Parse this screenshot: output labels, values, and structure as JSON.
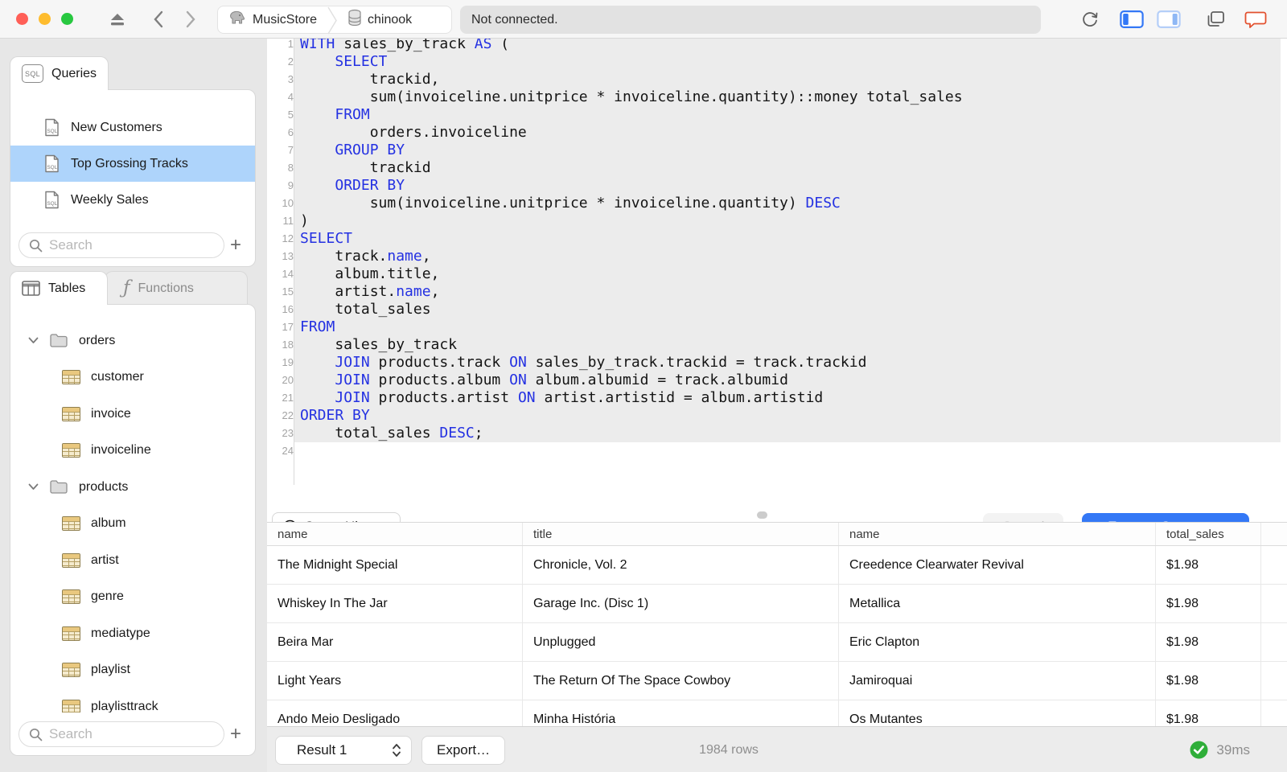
{
  "titlebar": {
    "breadcrumb": {
      "server": "MusicStore",
      "database": "chinook"
    },
    "status": "Not connected."
  },
  "colors": {
    "accent_blue": "#3478f6",
    "selection_blue": "#aed4fb",
    "keyword_blue": "#2431e2",
    "success_green": "#2fae39",
    "chat_orange": "#e2502e"
  },
  "sidebar": {
    "queries_tab": "Queries",
    "queries": [
      {
        "label": "New Customers",
        "selected": false
      },
      {
        "label": "Top Grossing Tracks",
        "selected": true
      },
      {
        "label": "Weekly Sales",
        "selected": false
      }
    ],
    "queries_search_placeholder": "Search",
    "tables_tab": "Tables",
    "functions_tab": "Functions",
    "tree": [
      {
        "type": "folder",
        "label": "orders"
      },
      {
        "type": "table",
        "label": "customer"
      },
      {
        "type": "table",
        "label": "invoice"
      },
      {
        "type": "table",
        "label": "invoiceline"
      },
      {
        "type": "folder",
        "label": "products"
      },
      {
        "type": "table",
        "label": "album"
      },
      {
        "type": "table",
        "label": "artist"
      },
      {
        "type": "table",
        "label": "genre"
      },
      {
        "type": "table",
        "label": "mediatype"
      },
      {
        "type": "table",
        "label": "playlist"
      },
      {
        "type": "table",
        "label": "playlisttrack"
      }
    ],
    "tables_search_placeholder": "Search"
  },
  "editor": {
    "lines": [
      [
        [
          "WITH",
          1
        ],
        [
          " sales_by_track ",
          0
        ],
        [
          "AS",
          1
        ],
        [
          " (",
          0
        ]
      ],
      [
        [
          "    ",
          0
        ],
        [
          "SELECT",
          1
        ]
      ],
      [
        [
          "        trackid,",
          0
        ]
      ],
      [
        [
          "        sum(invoiceline.unitprice * invoiceline.quantity)::money total_sales",
          0
        ]
      ],
      [
        [
          "    ",
          0
        ],
        [
          "FROM",
          1
        ]
      ],
      [
        [
          "        orders.invoiceline",
          0
        ]
      ],
      [
        [
          "    ",
          0
        ],
        [
          "GROUP BY",
          1
        ]
      ],
      [
        [
          "        trackid",
          0
        ]
      ],
      [
        [
          "    ",
          0
        ],
        [
          "ORDER BY",
          1
        ]
      ],
      [
        [
          "        sum(invoiceline.unitprice * invoiceline.quantity) ",
          0
        ],
        [
          "DESC",
          1
        ]
      ],
      [
        [
          ")",
          0
        ]
      ],
      [
        [
          "SELECT",
          1
        ]
      ],
      [
        [
          "    track.",
          0
        ],
        [
          "name",
          1
        ],
        [
          ",",
          0
        ]
      ],
      [
        [
          "    album.title,",
          0
        ]
      ],
      [
        [
          "    artist.",
          0
        ],
        [
          "name",
          1
        ],
        [
          ",",
          0
        ]
      ],
      [
        [
          "    total_sales",
          0
        ]
      ],
      [
        [
          "FROM",
          1
        ]
      ],
      [
        [
          "    sales_by_track",
          0
        ]
      ],
      [
        [
          "    ",
          0
        ],
        [
          "JOIN",
          1
        ],
        [
          " products.track ",
          0
        ],
        [
          "ON",
          1
        ],
        [
          " sales_by_track.trackid = track.trackid",
          0
        ]
      ],
      [
        [
          "    ",
          0
        ],
        [
          "JOIN",
          1
        ],
        [
          " products.album ",
          0
        ],
        [
          "ON",
          1
        ],
        [
          " album.albumid = track.albumid",
          0
        ]
      ],
      [
        [
          "    ",
          0
        ],
        [
          "JOIN",
          1
        ],
        [
          " products.artist ",
          0
        ],
        [
          "ON",
          1
        ],
        [
          " artist.artistid = album.artistid",
          0
        ]
      ],
      [
        [
          "ORDER BY",
          1
        ]
      ],
      [
        [
          "    total_sales ",
          0
        ],
        [
          "DESC",
          1
        ],
        [
          ";",
          0
        ]
      ],
      [
        [
          "",
          0
        ]
      ]
    ],
    "actions": {
      "query_history": "Query History",
      "cancel": "Cancel",
      "execute": "Execute Statement"
    }
  },
  "results": {
    "columns": [
      "name",
      "title",
      "name",
      "total_sales"
    ],
    "rows": [
      [
        "The Midnight Special",
        "Chronicle, Vol. 2",
        "Creedence Clearwater Revival",
        "$1.98"
      ],
      [
        "Whiskey In The Jar",
        "Garage Inc. (Disc 1)",
        "Metallica",
        "$1.98"
      ],
      [
        "Beira Mar",
        "Unplugged",
        "Eric Clapton",
        "$1.98"
      ],
      [
        "Light Years",
        "The Return Of The Space Cowboy",
        "Jamiroquai",
        "$1.98"
      ],
      [
        "Ando Meio Desligado",
        "Minha História",
        "Os Mutantes",
        "$1.98"
      ]
    ]
  },
  "statusbar": {
    "result_selector": "Result 1",
    "export_label": "Export…",
    "row_count": "1984 rows",
    "duration": "39ms"
  }
}
